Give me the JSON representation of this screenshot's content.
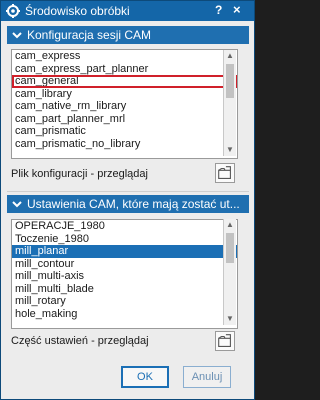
{
  "window": {
    "title": "Środowisko obróbki",
    "help": "?",
    "close": "×"
  },
  "section1": {
    "header": "Konfiguracja sesji CAM",
    "items": [
      "cam_express",
      "cam_express_part_planner",
      "cam_general",
      "cam_library",
      "cam_native_rm_library",
      "cam_part_planner_mrl",
      "cam_prismatic",
      "cam_prismatic_no_library"
    ],
    "highlighted_item": "cam_general",
    "browse_label": "Plik konfiguracji - przeglądaj"
  },
  "section2": {
    "header": "Ustawienia CAM, które mają zostać ut...",
    "items": [
      "OPERACJE_1980",
      "Toczenie_1980",
      "mill_planar",
      "mill_contour",
      "mill_multi-axis",
      "mill_multi_blade",
      "mill_rotary",
      "hole_making"
    ],
    "selected_item": "mill_planar",
    "browse_label": "Część ustawień - przeglądaj"
  },
  "buttons": {
    "ok": "OK",
    "cancel": "Anuluj"
  },
  "colors": {
    "titlebar": "#1466a8",
    "header": "#1f6fb0",
    "selection": "#1b6fb5",
    "highlight_outline": "#d0202a"
  },
  "icons": {
    "app": "cam-gear-icon",
    "section_toggle": "chevron-down-icon",
    "browse": "open-folder-icon"
  }
}
